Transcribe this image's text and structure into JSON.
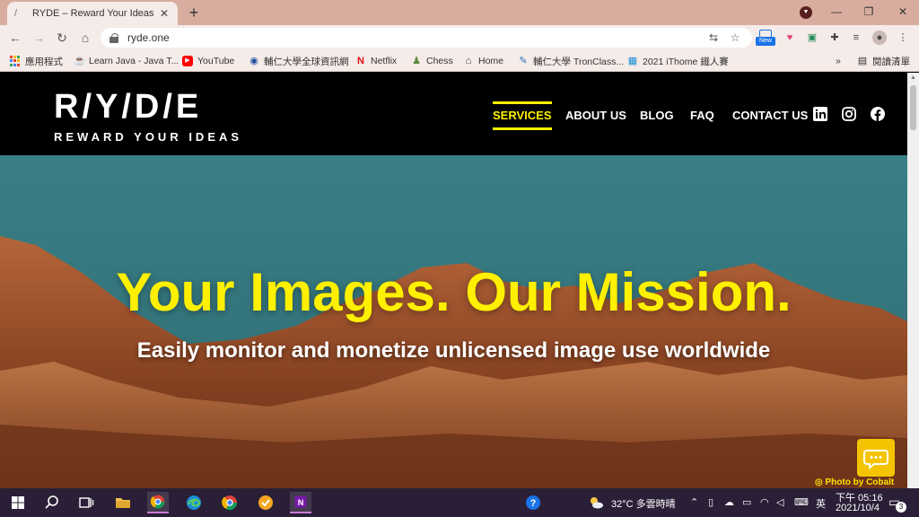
{
  "browser": {
    "tab_title": "RYDE – Reward Your Ideas",
    "tab_favicon": "/",
    "url": "ryde.one",
    "new_badge": "New",
    "bookmarks": [
      {
        "label": "應用程式",
        "icon": "apps-icon"
      },
      {
        "label": "Learn Java - Java T...",
        "icon": "learn-java-icon"
      },
      {
        "label": "YouTube",
        "icon": "youtube-icon"
      },
      {
        "label": "輔仁大學全球資訊網",
        "icon": "fju-icon"
      },
      {
        "label": "Netflix",
        "icon": "netflix-icon"
      },
      {
        "label": "Chess",
        "icon": "chess-icon"
      },
      {
        "label": "Home",
        "icon": "home-icon"
      },
      {
        "label": "輔仁大學 TronClass...",
        "icon": "tronclass-icon"
      },
      {
        "label": "2021 iThome 鐵人賽",
        "icon": "ithome-icon"
      }
    ],
    "more_bookmarks": "»",
    "reading_list": "閱讀清單"
  },
  "site": {
    "logo_mark": "R/Y/D/E",
    "logo_tagline": "REWARD YOUR IDEAS",
    "nav": [
      {
        "label": "SERVICES",
        "active": true
      },
      {
        "label": "ABOUT US",
        "active": false
      },
      {
        "label": "BLOG",
        "active": false
      },
      {
        "label": "FAQ",
        "active": false
      },
      {
        "label": "CONTACT US",
        "active": false
      }
    ],
    "social_icons": [
      "linkedin-icon",
      "instagram-icon",
      "facebook-icon"
    ],
    "accent_color": "#fff000"
  },
  "hero": {
    "title": "Your Images. Our Mission.",
    "subtitle": "Easily monitor and monetize unlicensed image use worldwide",
    "photo_credit": "Photo by Cobalt"
  },
  "taskbar": {
    "weather": "32°C  多雲時晴",
    "ime": "英",
    "time": "下午 05:16",
    "date": "2021/10/4",
    "notification_count": "3"
  }
}
